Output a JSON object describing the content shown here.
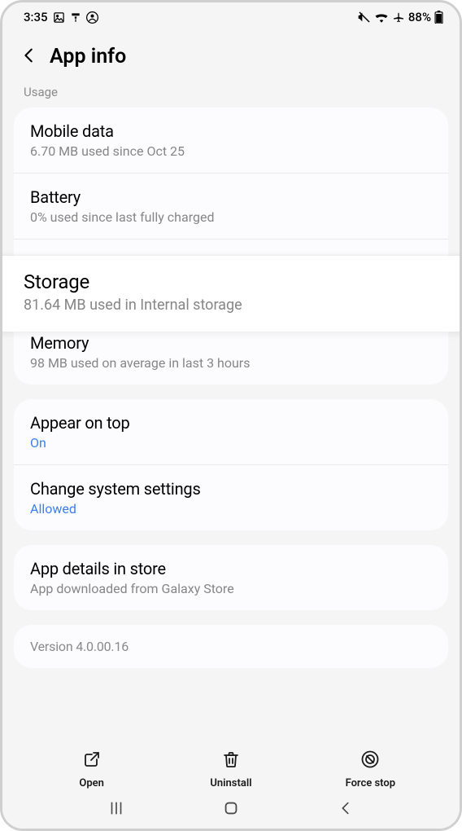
{
  "statusbar": {
    "time": "3:35",
    "battery_text": "88%"
  },
  "header": {
    "title": "App info"
  },
  "section_usage_label": "Usage",
  "usage": {
    "mobile_data": {
      "title": "Mobile data",
      "sub": "6.70 MB used since Oct 25"
    },
    "battery": {
      "title": "Battery",
      "sub": "0% used since last fully charged"
    },
    "storage": {
      "title": "Storage",
      "sub": "81.64 MB used in Internal storage"
    },
    "memory": {
      "title": "Memory",
      "sub": "98 MB used on average in last 3 hours"
    }
  },
  "permissions": {
    "appear_on_top": {
      "title": "Appear on top",
      "value": "On"
    },
    "change_system": {
      "title": "Change system settings",
      "value": "Allowed"
    }
  },
  "store": {
    "title": "App details in store",
    "sub": "App downloaded from Galaxy Store"
  },
  "version": {
    "text": "Version 4.0.00.16"
  },
  "actions": {
    "open": "Open",
    "uninstall": "Uninstall",
    "force_stop": "Force stop"
  }
}
